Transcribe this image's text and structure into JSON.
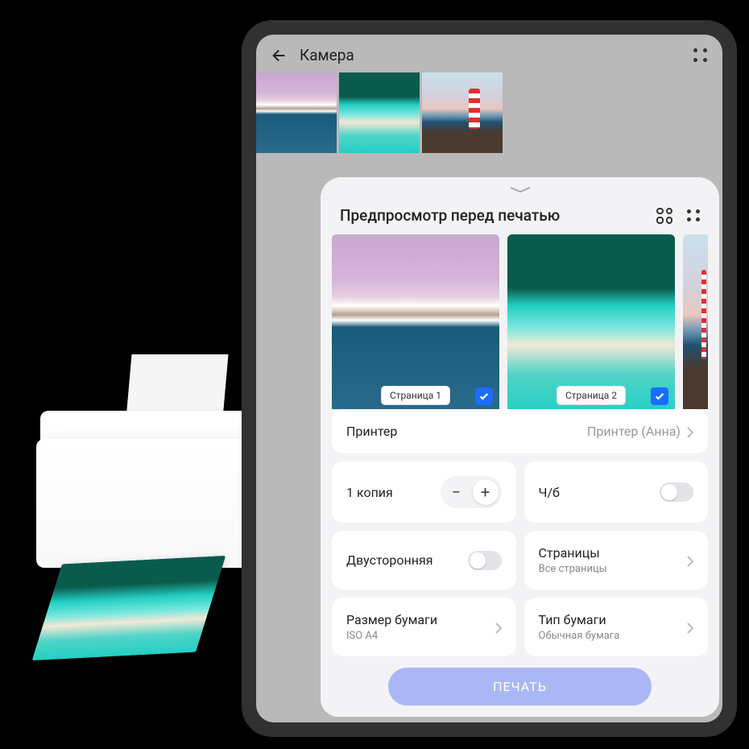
{
  "header": {
    "title": "Камера"
  },
  "panel": {
    "title": "Предпросмотр перед печатью",
    "pages": [
      {
        "label": "Страница 1",
        "selected": true
      },
      {
        "label": "Страница 2",
        "selected": true
      }
    ]
  },
  "settings": {
    "printer": {
      "label": "Принтер",
      "value": "Принтер (Анна)"
    },
    "copies": {
      "label": "1 копия"
    },
    "bw": {
      "label": "Ч/б"
    },
    "duplex": {
      "label": "Двусторонняя"
    },
    "pages": {
      "label": "Страницы",
      "value": "Все страницы"
    },
    "paperSize": {
      "label": "Размер бумаги",
      "value": "ISO A4"
    },
    "paperType": {
      "label": "Тип бумаги",
      "value": "Обычная бумага"
    }
  },
  "actions": {
    "print": "ПЕЧАТЬ"
  }
}
